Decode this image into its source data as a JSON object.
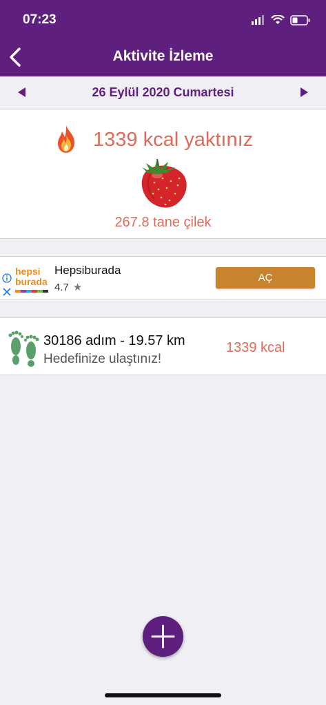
{
  "status_bar": {
    "time": "07:23"
  },
  "nav": {
    "title": "Aktivite İzleme"
  },
  "date_bar": {
    "date": "26 Eylül 2020 Cumartesi"
  },
  "summary": {
    "kcal_burned": "1339 kcal yaktınız",
    "equivalent": "267.8 tane çilek"
  },
  "ad": {
    "logo_line1": "hepsi",
    "logo_line2": "burada",
    "name": "Hepsiburada",
    "rating": "4.7",
    "star": "★",
    "button_label": "AÇ"
  },
  "activity": {
    "steps": "30186 adım - 19.57 km",
    "goal": "Hedefinize ulaştınız!",
    "kcal": "1339 kcal"
  },
  "colors": {
    "primary": "#5e1f7e",
    "accent_text": "#e06a5a",
    "ad_button": "#c8832e",
    "feet": "#5aa06a"
  },
  "icons": [
    "back-chevron-icon",
    "flame-icon",
    "strawberry-icon",
    "feet-icon",
    "plus-icon",
    "ad-info-icon",
    "ad-close-icon"
  ]
}
